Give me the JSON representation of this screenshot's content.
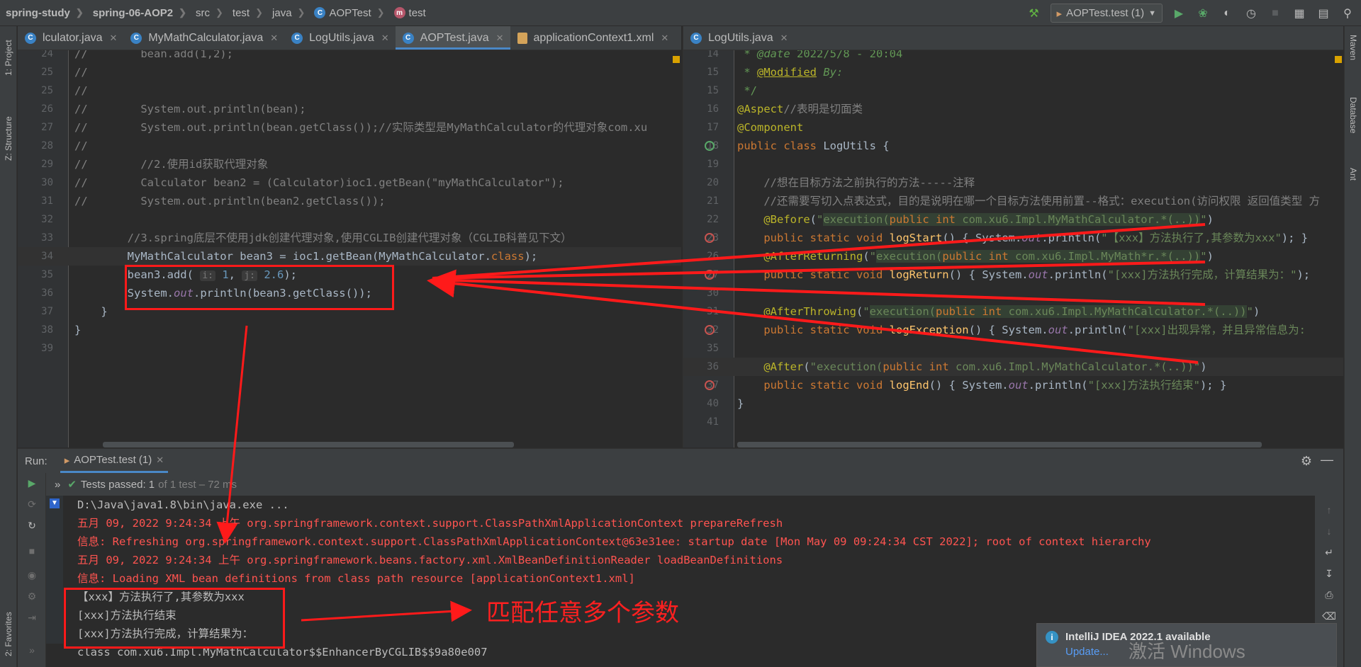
{
  "breadcrumb": [
    "spring-study",
    "spring-06-AOP2",
    "src",
    "test",
    "java",
    "AOPTest",
    "test"
  ],
  "toolbar": {
    "run_config": "AOPTest.test (1)"
  },
  "left_sidebar": {
    "tabs": [
      "1: Project",
      "Z: Structure",
      "2: Favorites"
    ]
  },
  "right_sidebar": {
    "tabs": [
      "Maven",
      "Database",
      "Ant"
    ]
  },
  "left_tabs": [
    {
      "label": "lculator.java",
      "icon": "c"
    },
    {
      "label": "MyMathCalculator.java",
      "icon": "c"
    },
    {
      "label": "LogUtils.java",
      "icon": "c"
    },
    {
      "label": "AOPTest.java",
      "icon": "c",
      "active": true
    },
    {
      "label": "applicationContext1.xml",
      "icon": "xml"
    }
  ],
  "right_tabs": [
    {
      "label": "LogUtils.java",
      "icon": "c"
    }
  ],
  "left_code": [
    {
      "n": "24",
      "html": "<span class='cm'>//        bean.add(1,2);</span>"
    },
    {
      "n": "25",
      "html": "<span class='cm'>//</span>"
    },
    {
      "n": "25",
      "html": "<span class='cm'>//</span>"
    },
    {
      "n": "26",
      "html": "<span class='cm'>//        System.out.println(bean);</span>"
    },
    {
      "n": "27",
      "html": "<span class='cm'>//        System.out.println(bean.getClass());//实际类型是MyMathCalculator的代理对象com.xu</span>"
    },
    {
      "n": "28",
      "html": "<span class='cm'>//</span>"
    },
    {
      "n": "29",
      "html": "<span class='cm'>//        //2.使用id获取代理对象</span>"
    },
    {
      "n": "30",
      "html": "<span class='cm'>//        Calculator bean2 = (Calculator)ioc1.getBean(\"myMathCalculator\");</span>"
    },
    {
      "n": "31",
      "html": "<span class='cm'>//        System.out.println(bean2.getClass());</span>"
    },
    {
      "n": "32",
      "html": ""
    },
    {
      "n": "33",
      "html": "        <span class='cm'>//3.spring底层不使用jdk创建代理对象,使用CGLIB创建代理对象（CGLIB科普见下文）</span>"
    },
    {
      "n": "34",
      "html": "        MyMathCalculator bean3 = ioc1.getBean(MyMathCalculator.<span class='kw'>class</span>);",
      "cur": true
    },
    {
      "n": "35",
      "html": "        bean3.add( <span class='hint'>i:</span> <span style='color:#6897bb'>1</span>, <span class='hint'>j:</span> <span style='color:#6897bb'>2.6</span>);"
    },
    {
      "n": "36",
      "html": "        System.<span class='sf'>out</span>.println(bean3.getClass());"
    },
    {
      "n": "37",
      "html": "    }"
    },
    {
      "n": "38",
      "html": "}"
    },
    {
      "n": "39",
      "html": ""
    }
  ],
  "right_code": [
    {
      "n": "14",
      "html": "<span class='ecm'> * <span class='it'>@date</span> 2022/5/8 - 20:04</span>"
    },
    {
      "n": "15",
      "html": "<span class='ecm'> * <span class='an' style='text-decoration:underline'>@Modified</span> <span class='it'>By:</span></span>"
    },
    {
      "n": "15",
      "html": "<span class='ecm'> */</span>"
    },
    {
      "n": "16",
      "html": "<span class='an'>@Aspect</span><span class='cm'>//表明是切面类</span>"
    },
    {
      "n": "17",
      "html": "<span class='an'>@Component</span>"
    },
    {
      "n": "18",
      "html": "<span class='kw'>public class</span> LogUtils {"
    },
    {
      "n": "19",
      "html": ""
    },
    {
      "n": "20",
      "html": "    <span class='cm'>//想在目标方法之前执行的方法-----注释</span>"
    },
    {
      "n": "21",
      "html": "    <span class='cm'>//还需要写切入点表达式，目的是说明在哪一个目标方法使用前置--格式：execution(访问权限 返回值类型 方</span>"
    },
    {
      "n": "22",
      "html": "    <span class='an'>@Before</span>(<span class='st'>\"<span class='hl'>execution(<span class='kw'>public int</span> com.xu6.Impl.MyMathCalculator.*(..))</span>\"</span>)"
    },
    {
      "n": "23",
      "html": "    <span class='kw'>public static void</span> <span style='color:#ffc66d'>logStart</span>() { System.<span class='sf'>out</span>.println(<span class='st'>\"【xxx】方法执行了,其参数为xxx\"</span>); }"
    },
    {
      "n": "26",
      "html": "    <span class='an'>@AfterReturning</span>(<span class='st'>\"<span class='hl'>execution(<span class='kw'>public int</span> com.xu6.Impl.MyMath*r.*(..))</span>\"</span>)"
    },
    {
      "n": "27",
      "html": "    <span class='kw'>public static void</span> <span style='color:#ffc66d'>logReturn</span>() { System.<span class='sf'>out</span>.println(<span class='st'>\"[xxx]方法执行完成，计算结果为：\"</span>);"
    },
    {
      "n": "30",
      "html": ""
    },
    {
      "n": "31",
      "html": "    <span class='an'>@AfterThrowing</span>(<span class='st'>\"<span class='hl'>execution(<span class='kw'>public int</span> com.xu6.Impl.MyMathCalculator.*(..))</span>\"</span>)"
    },
    {
      "n": "32",
      "html": "    <span class='kw'>public static void</span> <span style='color:#ffc66d'>logException</span>() { System.<span class='sf'>out</span>.println(<span class='st'>\"[xxx]出现异常，并且异常信息为:</span>"
    },
    {
      "n": "35",
      "html": ""
    },
    {
      "n": "36",
      "html": "    <span class='an'>@After</span>(<span class='st'>\"execution(<span class='kw'>public int</span> com.xu6.Impl.MyMathCalculator.*(..))\"</span>)",
      "cur": true
    },
    {
      "n": "37",
      "html": "    <span class='kw'>public static void</span> <span style='color:#ffc66d'>logEnd</span>() { System.<span class='sf'>out</span>.println(<span class='st'>\"[xxx]方法执行结束\"</span>); }"
    },
    {
      "n": "40",
      "html": "}"
    },
    {
      "n": "41",
      "html": ""
    }
  ],
  "run": {
    "label": "Run:",
    "tab": "AOPTest.test (1)",
    "status": "Tests passed: 1",
    "status_detail": "of 1 test – 72 ms"
  },
  "console": [
    {
      "text": "D:\\Java\\java1.8\\bin\\java.exe ...",
      "cls": "gray"
    },
    {
      "text": "五月 09, 2022 9:24:34 上午 org.springframework.context.support.ClassPathXmlApplicationContext prepareRefresh",
      "cls": "red"
    },
    {
      "text": "信息: Refreshing org.springframework.context.support.ClassPathXmlApplicationContext@63e31ee: startup date [Mon May 09 09:24:34 CST 2022]; root of context hierarchy",
      "cls": "red"
    },
    {
      "text": "五月 09, 2022 9:24:34 上午 org.springframework.beans.factory.xml.XmlBeanDefinitionReader loadBeanDefinitions",
      "cls": "red"
    },
    {
      "text": "信息: Loading XML bean definitions from class path resource [applicationContext1.xml]",
      "cls": "red"
    },
    {
      "text": "【xxx】方法执行了,其参数为xxx",
      "cls": "gray"
    },
    {
      "text": "[xxx]方法执行结束",
      "cls": "gray"
    },
    {
      "text": "[xxx]方法执行完成，计算结果为：",
      "cls": "gray"
    },
    {
      "text": "class com.xu6.Impl.MyMathCalculator$$EnhancerByCGLIB$$9a80e007",
      "cls": "gray"
    }
  ],
  "notification": {
    "title": "IntelliJ IDEA 2022.1 available",
    "link": "Update..."
  },
  "watermark": "激活 Windows",
  "annotation": "匹配任意多个参数",
  "colors": {
    "accent": "#4a88c7",
    "annotation_red": "#ff1a1a",
    "console_red": "#ff5450"
  }
}
